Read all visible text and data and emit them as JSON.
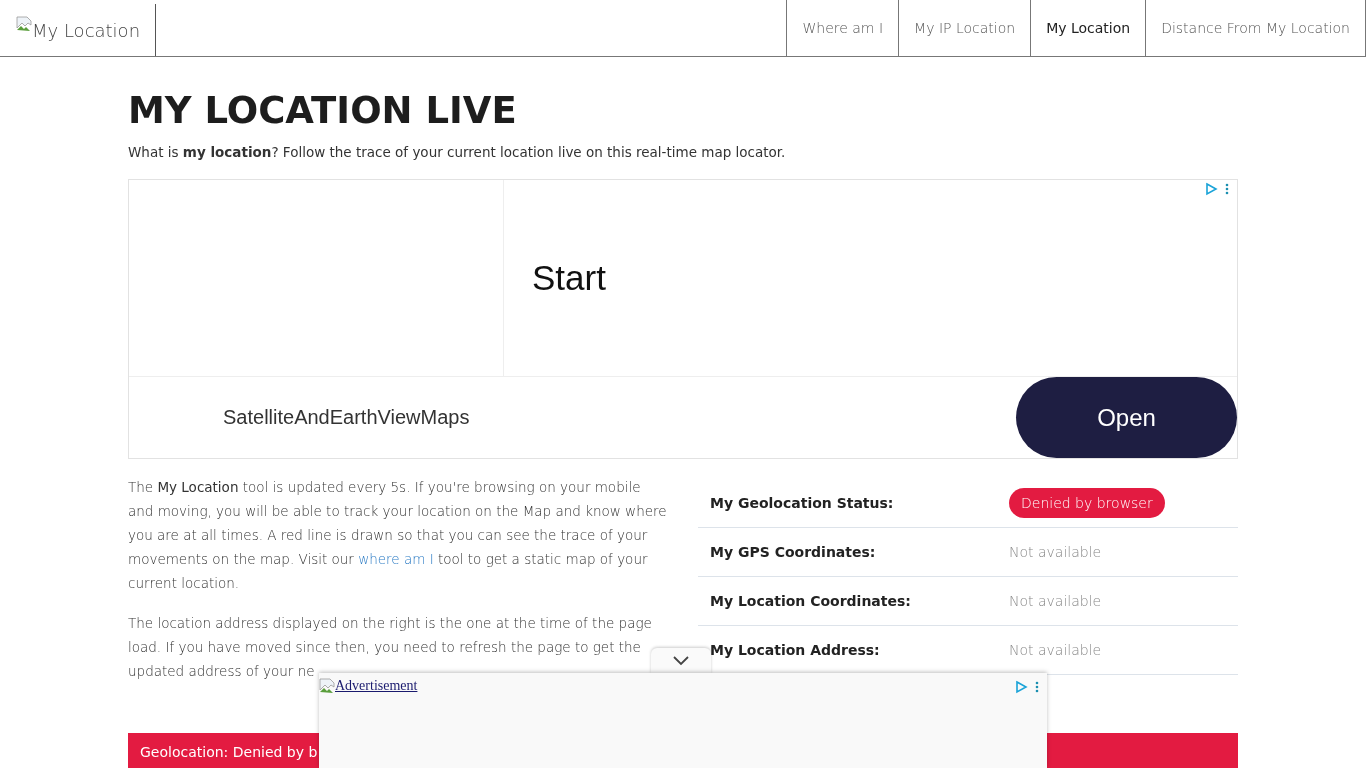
{
  "logo": {
    "alt": "My Location"
  },
  "nav": [
    {
      "label": "Where am I",
      "selected": false
    },
    {
      "label": "My IP Location",
      "selected": false
    },
    {
      "label": "My Location",
      "selected": true
    },
    {
      "label": "Distance From My Location",
      "selected": false
    }
  ],
  "heading": "MY LOCATION LIVE",
  "intro": "What is **my location**? Follow the trace of your current location live on this real-time map locator.",
  "ad": {
    "headline": "Start",
    "advertiser": "SatelliteAndEarthViewMaps",
    "button": "Open"
  },
  "paragraphs": [
    {
      "before": "The **My Location** tool is updated every 5s. If you're browsing on your mobile and moving, you will be able to track your location on the Map and know where you are at all times. A red line is drawn so that you can see the trace of your movements on the map. Visit our ",
      "link": "where am I",
      "after": " tool to get a static map of your current location."
    },
    {
      "before": "The location address displayed on the right is the one at the time of the page load. If you have moved since then, you need to refresh the page to get the updated address of your ne"
    }
  ],
  "info": [
    {
      "label": "My Geolocation Status:",
      "value": "Denied by browser",
      "kind": "badge"
    },
    {
      "label": "My GPS Coordinates:",
      "value": "Not available",
      "kind": "text"
    },
    {
      "label": "My Location Coordinates:",
      "value": "Not available",
      "kind": "text"
    },
    {
      "label": "My Location Address:",
      "value": "Not available",
      "kind": "text"
    }
  ],
  "banner": "Geolocation: Denied by b",
  "bottom_ad": {
    "link": "Advertisement"
  }
}
